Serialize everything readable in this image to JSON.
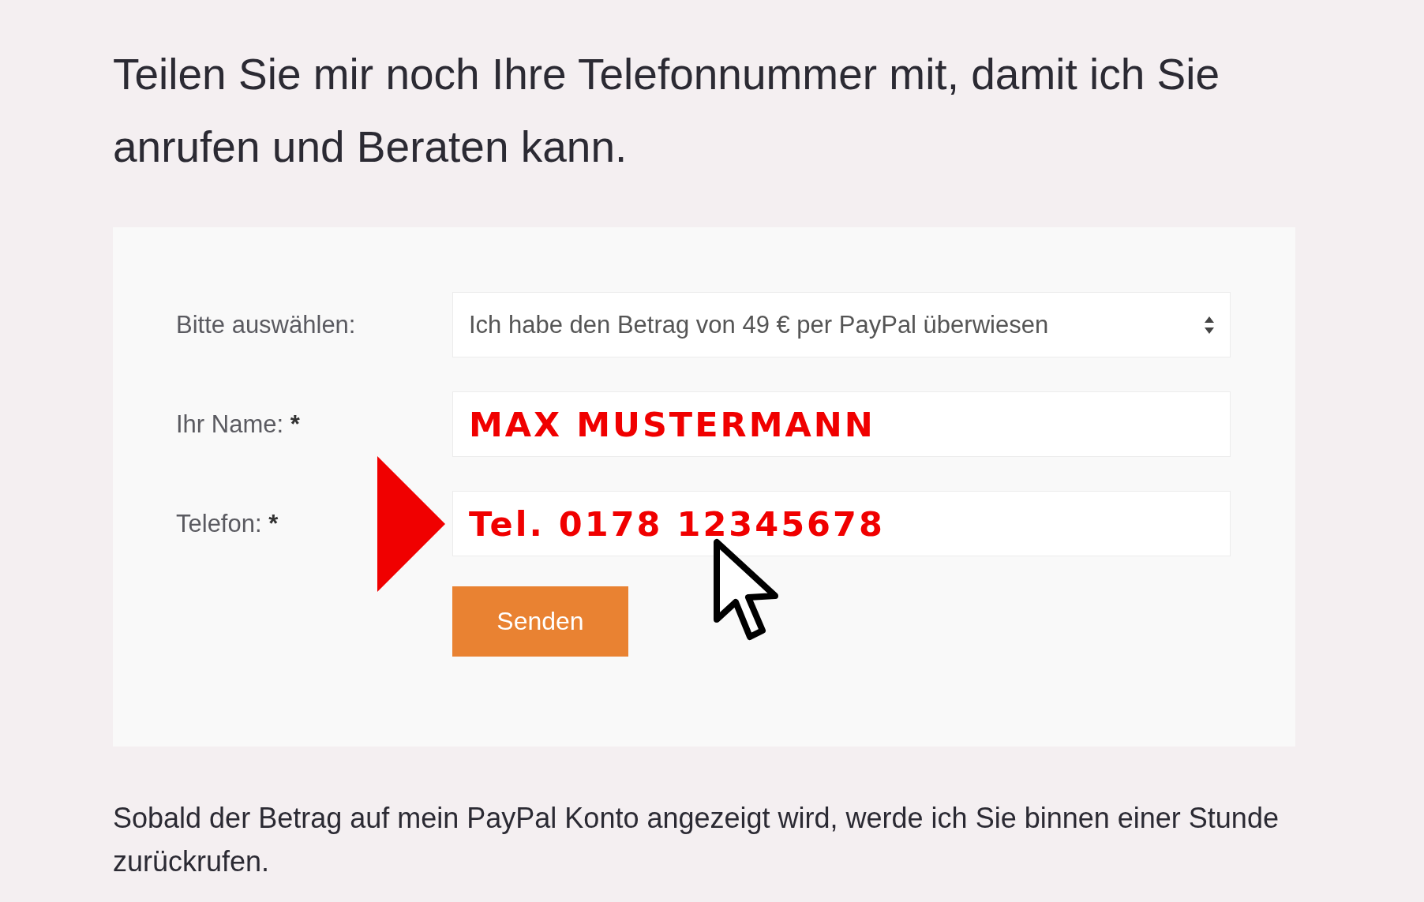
{
  "heading": "Teilen Sie mir noch Ihre Telefonnummer mit, damit ich Sie anrufen und Beraten kann.",
  "form": {
    "fields": [
      {
        "kind": "select",
        "label": "Bitte auswählen:",
        "value": "Ich habe den Betrag von 49 € per PayPal überwiesen"
      },
      {
        "kind": "text",
        "label": "Ihr Name:",
        "mark": "*",
        "value": "MAX MUSTERMANN"
      },
      {
        "kind": "text",
        "label": "Telefon:",
        "mark": "*",
        "value": "Tel. 0178 12345678"
      }
    ],
    "submit": "Senden"
  },
  "note": "Sobald der Betrag auf mein PayPal Konto angezeigt wird, werde ich Sie binnen einer Stunde zurückrufen."
}
